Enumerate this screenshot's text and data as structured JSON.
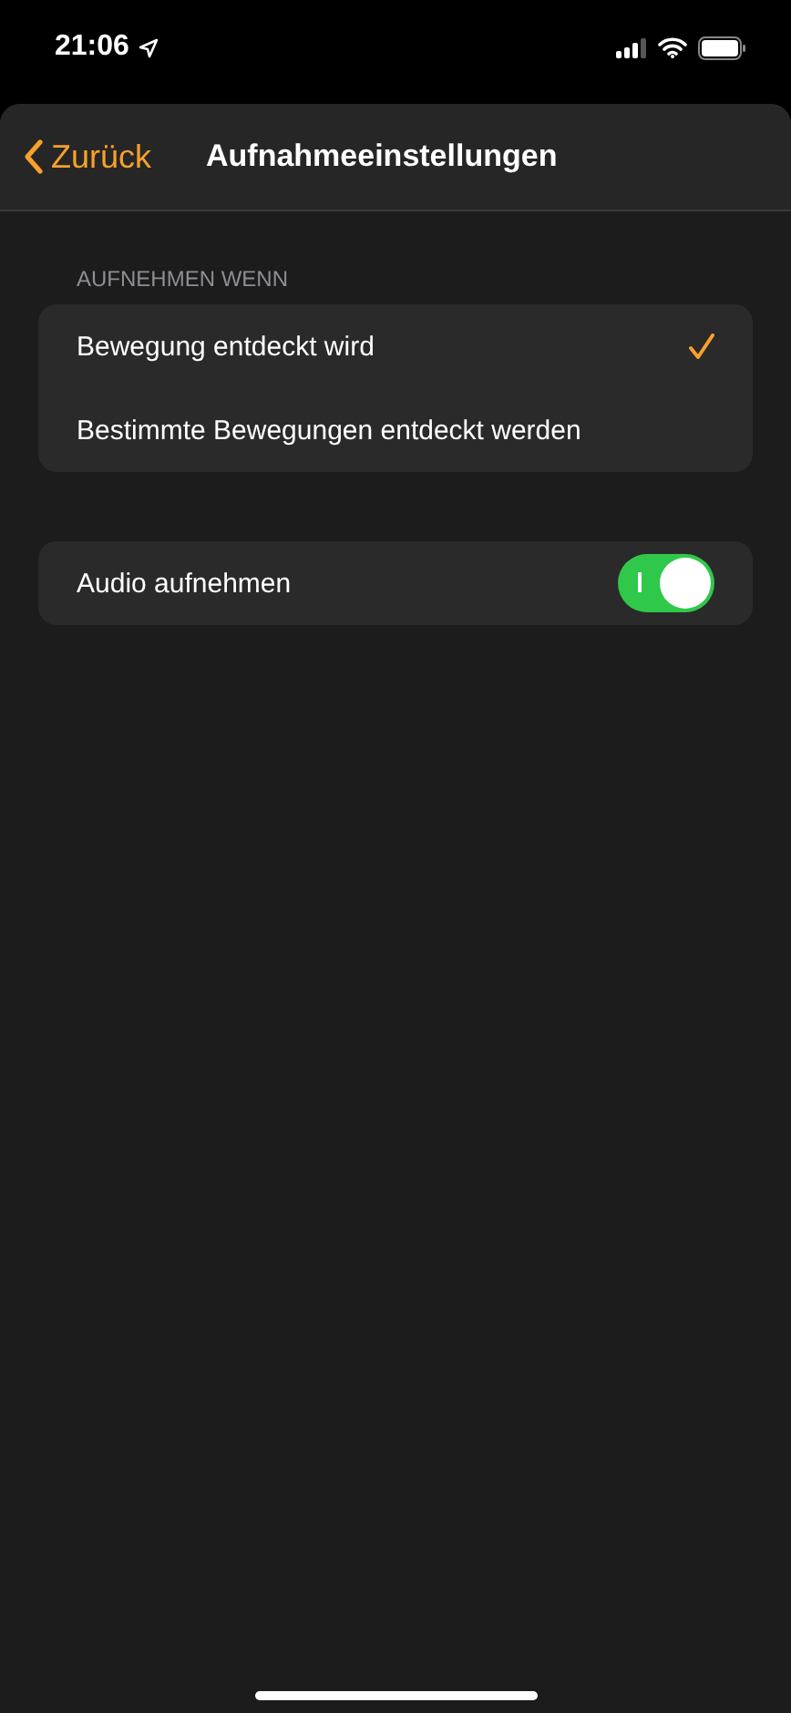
{
  "status_bar": {
    "time": "21:06"
  },
  "nav": {
    "back": "Zurück",
    "title": "Aufnahmeeinstellungen"
  },
  "record_when": {
    "header": "AUFNEHMEN WENN",
    "options": [
      {
        "label": "Bewegung entdeckt wird",
        "selected": true
      },
      {
        "label": "Bestimmte Bewegungen entdeckt werden",
        "selected": false
      }
    ]
  },
  "audio": {
    "label": "Audio aufnehmen",
    "on": true
  }
}
